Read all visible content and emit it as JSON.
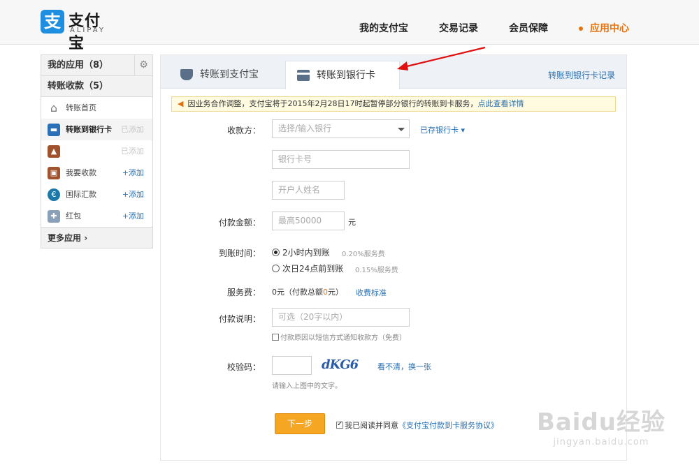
{
  "logo": {
    "cn": "支付宝",
    "en": "ALIPAY",
    "mark": "支"
  },
  "topnav": [
    "我的支付宝",
    "交易记录",
    "会员保障",
    "应用中心"
  ],
  "sidebar": {
    "my_apps": "我的应用（8）",
    "transfer_section": "转账收款（5）",
    "items": [
      {
        "label": "转账首页",
        "status": ""
      },
      {
        "label": "转账到银行卡",
        "status": "已添加"
      },
      {
        "label": "",
        "status": "已添加"
      },
      {
        "label": "我要收款",
        "status": "+添加"
      },
      {
        "label": "国际汇款",
        "status": "+添加"
      },
      {
        "label": "红包",
        "status": "+添加"
      }
    ],
    "more": "更多应用"
  },
  "tabs": {
    "tab1": "转账到支付宝",
    "tab2": "转账到银行卡",
    "history_link": "转账到银行卡记录"
  },
  "notice": {
    "text": "因业务合作调整，支付宝将于2015年2月28日17时起暂停部分银行的转账到卡服务，",
    "link": "点此查看详情"
  },
  "form": {
    "payee_label": "收款方：",
    "bank_placeholder": "选择/输入银行",
    "saved_cards": "已存银行卡",
    "card_placeholder": "银行卡号",
    "name_placeholder": "开户人姓名",
    "amount_label": "付款金额：",
    "amount_placeholder": "最高50000",
    "amount_unit": "元",
    "arrival_label": "到账时间：",
    "opt1": "2小时内到账",
    "opt1_fee": "0.20%服务费",
    "opt2": "次日24点前到账",
    "opt2_fee": "0.15%服务费",
    "fee_label": "服务费：",
    "fee_value_a": "0元（付款总额",
    "fee_value_b": "0",
    "fee_value_c": "元）",
    "fee_link": "收费标准",
    "memo_label": "付款说明：",
    "memo_placeholder": "可选（20字以内）",
    "sms_notice": "付款原因以短信方式通知收款方（免费）",
    "captcha_label": "校验码：",
    "captcha_image": "dKG6",
    "captcha_refresh": "看不清，换一张",
    "captcha_hint": "请输入上图中的文字。",
    "submit": "下一步",
    "agree_text": "我已阅读并同意",
    "agree_link": "《支付宝付款到卡服务协议》"
  },
  "watermark": {
    "main": "Baidu经验",
    "sub": "jingyan.baidu.com"
  },
  "colors": {
    "accent": "#e8730c",
    "link": "#2a6fb0",
    "button": "#f5a623",
    "arrow": "#e01010"
  }
}
